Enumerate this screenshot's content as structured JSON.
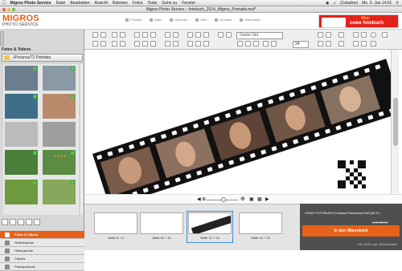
{
  "menubar": {
    "app": "Migros Photo Service",
    "items": [
      "Datei",
      "Bearbeiten",
      "Ansicht",
      "Rahmen",
      "Fotos",
      "Texte",
      "Gehe zu",
      "Fenster"
    ],
    "user": "(Celadon)",
    "clock": "Mo. 9. Jun 14:01"
  },
  "window": {
    "title": "Migros Photo Service – fotobuch_2014_Migros_Portraits.mcf*"
  },
  "brand": {
    "name": "MIGROS",
    "sub": "PHOTO SERVICE"
  },
  "topnav": [
    "Produkt",
    "Datei",
    "Optionen",
    "Hilfe",
    "Drucken",
    "Warenkorb"
  ],
  "cewe": {
    "mein": "Mein",
    "label": "cewe fotobuch"
  },
  "leftpanel": {
    "title": "Fotos & Videos",
    "folder": "../Pictures/72 Portraits",
    "stars": "★★★★",
    "menu": [
      "Fotos & Videos",
      "Seitenlayouts",
      "Hintergründe",
      "Cliparts",
      "Passepartouts"
    ]
  },
  "toolbar": {
    "font": "Orator Std",
    "size": "24"
  },
  "pages": [
    {
      "label": "Seite 8 + 9"
    },
    {
      "label": "Seite 10 + 11"
    },
    {
      "label": "Seite 12 + 13"
    },
    {
      "label": "Seite 14 + 15"
    }
  ],
  "cart": {
    "product": "CEWE FOTOBUCH Compact Panorama Heft (26 S.)",
    "price": "CHF 23.90",
    "button": "In den Warenkorb",
    "note": "inkl. MwSt. zzgl. Versandkosten"
  },
  "colors": {
    "accent": "#e8611a",
    "check": "#46b53a",
    "cewe": "#e2231a"
  }
}
